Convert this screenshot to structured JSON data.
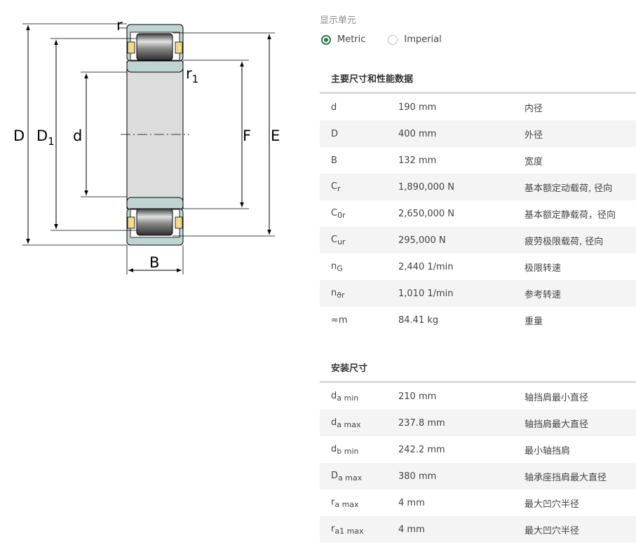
{
  "diagram": {
    "labels": {
      "D": "D",
      "D1_main": "D",
      "D1_sub": "1",
      "d": "d",
      "r": "r",
      "r1_main": "r",
      "r1_sub": "1",
      "F": "F",
      "E": "E",
      "B": "B"
    }
  },
  "units": {
    "label": "显示单元",
    "options": [
      {
        "label": "Metric",
        "selected": true
      },
      {
        "label": "Imperial",
        "selected": false
      }
    ]
  },
  "main_dims": {
    "title": "主要尺寸和性能数据",
    "rows": [
      {
        "sym": "d",
        "sub": "",
        "value": "190 mm",
        "desc": "内径"
      },
      {
        "sym": "D",
        "sub": "",
        "value": "400 mm",
        "desc": "外径"
      },
      {
        "sym": "B",
        "sub": "",
        "value": "132 mm",
        "desc": "宽度"
      },
      {
        "sym": "C",
        "sub": "r",
        "value": "1,890,000 N",
        "desc": "基本额定动载荷, 径向"
      },
      {
        "sym": "C",
        "sub": "0r",
        "value": "2,650,000 N",
        "desc": "基本额定静载荷，径向"
      },
      {
        "sym": "C",
        "sub": "ur",
        "value": "295,000 N",
        "desc": "疲劳极限载荷, 径向"
      },
      {
        "sym": "n",
        "sub": "G",
        "value": "2,440 1/min",
        "desc": "极限转速"
      },
      {
        "sym": "n",
        "sub": "ϑr",
        "value": "1,010 1/min",
        "desc": "参考转速"
      },
      {
        "sym": "≈m",
        "sub": "",
        "value": "84.41 kg",
        "desc": "重量"
      }
    ]
  },
  "mounting": {
    "title": "安装尺寸",
    "rows": [
      {
        "sym": "d",
        "sub": "a min",
        "value": "210 mm",
        "desc": "轴挡肩最小直径"
      },
      {
        "sym": "d",
        "sub": "a max",
        "value": "237.8 mm",
        "desc": "轴挡肩最大直径"
      },
      {
        "sym": "d",
        "sub": "b min",
        "value": "242.2 mm",
        "desc": "最小轴挡肩"
      },
      {
        "sym": "D",
        "sub": "a max",
        "value": "380 mm",
        "desc": "轴承座挡肩最大直径"
      },
      {
        "sym": "r",
        "sub": "a max",
        "value": "4 mm",
        "desc": "最大凹穴半径"
      },
      {
        "sym": "r",
        "sub": "a1 max",
        "value": "4 mm",
        "desc": "最大凹穴半径"
      }
    ]
  }
}
